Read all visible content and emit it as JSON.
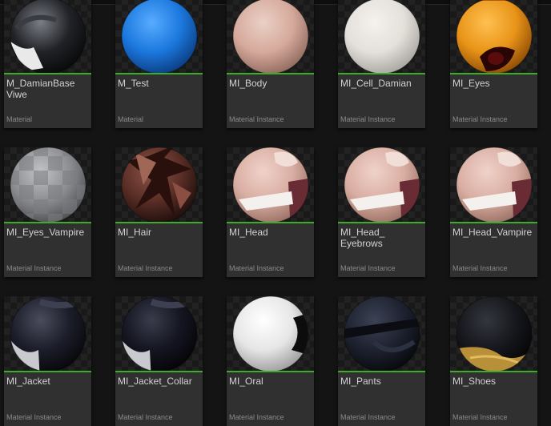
{
  "assets": [
    {
      "name": "M_DamianBase Viwe",
      "type": "Material",
      "sphere": {
        "base": "#202226",
        "light": "#7a7d84",
        "dark": "#08090a"
      },
      "detail": "damian"
    },
    {
      "name": "M_Test",
      "type": "Material",
      "sphere": {
        "base": "#1c78de",
        "light": "#58acff",
        "dark": "#0b3c80"
      },
      "detail": "none"
    },
    {
      "name": "MI_Body",
      "type": "Material Instance",
      "sphere": {
        "base": "#d6aa9c",
        "light": "#ead0c6",
        "dark": "#906a5e"
      },
      "detail": "none"
    },
    {
      "name": "MI_Cell_Damian",
      "type": "Material Instance",
      "sphere": {
        "base": "#e4e0da",
        "light": "#f4f2ee",
        "dark": "#a8a49f"
      },
      "detail": "none"
    },
    {
      "name": "MI_Eyes",
      "type": "Material Instance",
      "sphere": {
        "base": "#e89418",
        "light": "#ffc050",
        "dark": "#8c4a06"
      },
      "detail": "eyes"
    },
    {
      "name": "MI_Eyes_Vampire",
      "type": "Material Instance",
      "sphere": {
        "base": "#8c8e91",
        "light": "#c0c2c5",
        "dark": "#4c4e51"
      },
      "detail": "checker"
    },
    {
      "name": "MI_Hair",
      "type": "Material Instance",
      "sphere": {
        "base": "#5a2e26",
        "light": "#8c5448",
        "dark": "#1e0e0c"
      },
      "detail": "hair"
    },
    {
      "name": "MI_Head",
      "type": "Material Instance",
      "sphere": {
        "base": "#d9aea2",
        "light": "#f0d2ca",
        "dark": "#9a7066"
      },
      "detail": "head"
    },
    {
      "name": "MI_Head_ Eyebrows",
      "type": "Material Instance",
      "sphere": {
        "base": "#d9aea2",
        "light": "#f0d2ca",
        "dark": "#9a7066"
      },
      "detail": "head"
    },
    {
      "name": "MI_Head_Vampire",
      "type": "Material Instance",
      "sphere": {
        "base": "#d9aea2",
        "light": "#f0d2ca",
        "dark": "#9a7066"
      },
      "detail": "head"
    },
    {
      "name": "MI_Jacket",
      "type": "Material Instance",
      "sphere": {
        "base": "#1c1d2a",
        "light": "#4a4c5c",
        "dark": "#07070b"
      },
      "detail": "jacket"
    },
    {
      "name": "MI_Jacket_Collar",
      "type": "Material Instance",
      "sphere": {
        "base": "#141520",
        "light": "#3a3c4c",
        "dark": "#050508"
      },
      "detail": "jacket"
    },
    {
      "name": "MI_Oral",
      "type": "Material Instance",
      "sphere": {
        "base": "#e6e6e6",
        "light": "#ffffff",
        "dark": "#9c9c9c"
      },
      "detail": "oral"
    },
    {
      "name": "MI_Pants",
      "type": "Material Instance",
      "sphere": {
        "base": "#1e2230",
        "light": "#3c4254",
        "dark": "#08090d"
      },
      "detail": "pants"
    },
    {
      "name": "MI_Shoes",
      "type": "Material Instance",
      "sphere": {
        "base": "#16171c",
        "light": "#34363e",
        "dark": "#050506"
      },
      "detail": "shoes"
    }
  ],
  "colors": {
    "selected_bar": "#3dac28",
    "tile_bg": "#303030",
    "window_bg": "#141414"
  }
}
